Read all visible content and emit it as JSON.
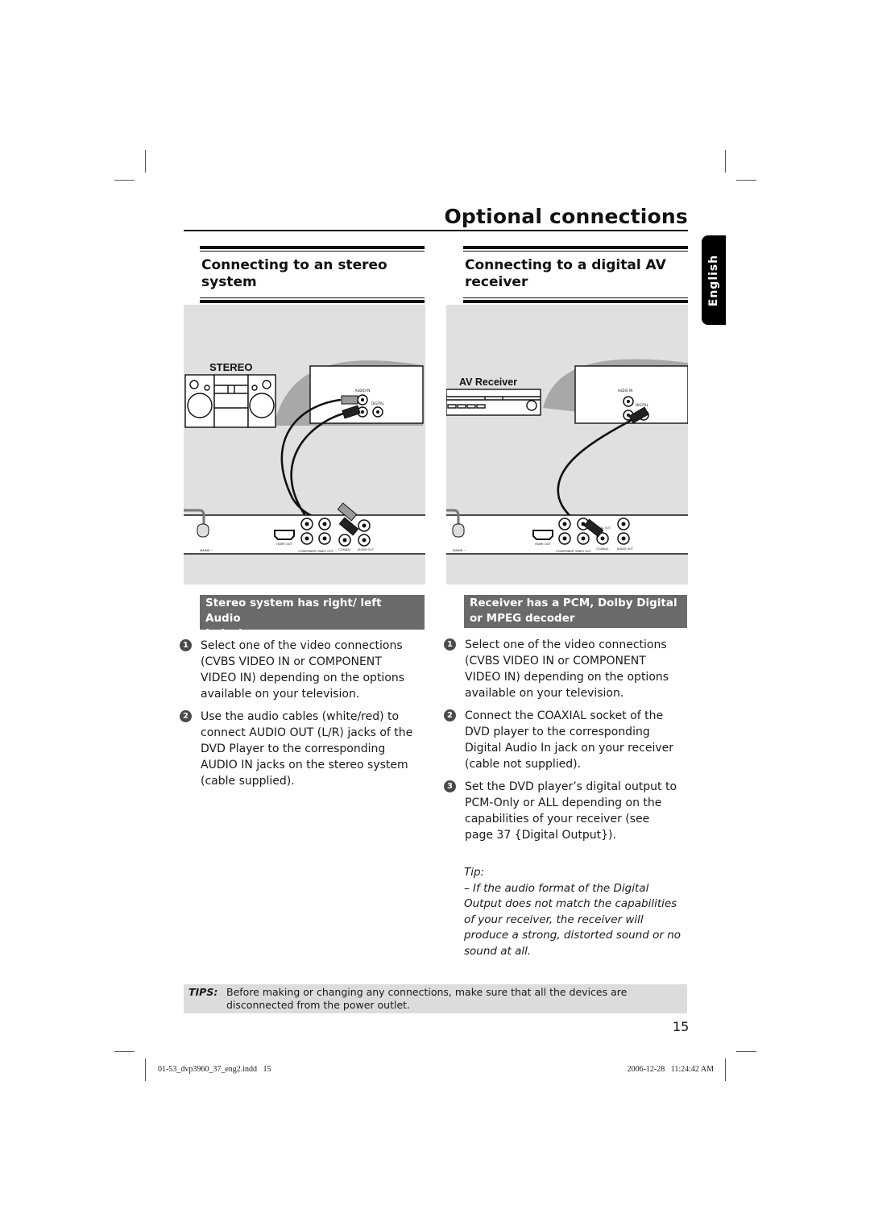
{
  "page": {
    "title": "Optional connections",
    "language_tab": "English",
    "page_number": "15"
  },
  "left_section": {
    "heading": "Connecting to an stereo system",
    "heading_lines": [
      "Connecting to an stereo",
      "system"
    ],
    "figure": {
      "device_label": "STEREO",
      "jack_labels": {
        "audio_in": "AUDIO IN",
        "digital": "DIGITAL",
        "mains": "MAINS ~",
        "hdmi_out": "HDMI OUT",
        "component_video_out": "COMPONENT VIDEO OUT",
        "coaxial": "COAXIAL",
        "audio_out": "AUDIO OUT"
      }
    },
    "condition": [
      "Stereo system has right/ left Audio",
      "In jacks"
    ],
    "steps": [
      {
        "num": "1",
        "text": "Select one of the video connections (CVBS VIDEO IN or COMPONENT VIDEO IN) depending on the options available on your television."
      },
      {
        "num": "2",
        "text": "Use the audio cables (white/red) to connect AUDIO OUT (L/R) jacks of the DVD Player to the corresponding AUDIO IN jacks on the stereo system (cable supplied)."
      }
    ]
  },
  "right_section": {
    "heading": "Connecting to a digital AV receiver",
    "heading_lines": [
      "Connecting to a digital AV",
      "receiver"
    ],
    "figure": {
      "device_label": "AV Receiver",
      "jack_labels": {
        "audio_in": "AUDIO IN",
        "digital": "DIGITAL",
        "mains": "MAINS ~",
        "hdmi_out": "HDMI OUT",
        "component_video_out": "COMPONENT VIDEO OUT",
        "digital_out": "DIGITAL OUT",
        "coaxial": "COAXIAL",
        "audio_out": "AUDIO OUT"
      }
    },
    "condition": [
      "Receiver has a PCM, Dolby Digital",
      "or MPEG decoder"
    ],
    "steps": [
      {
        "num": "1",
        "text": "Select one of the video connections (CVBS VIDEO IN or COMPONENT VIDEO IN) depending on the options available on your television."
      },
      {
        "num": "2",
        "text": "Connect the COAXIAL socket of the DVD player to the corresponding Digital Audio In jack on your receiver (cable not supplied)."
      },
      {
        "num": "3",
        "text": "Set the DVD player’s digital output to PCM-Only or ALL depending on the capabilities of your receiver (see page 37 {Digital Output})."
      }
    ],
    "tip": {
      "label": "Tip:",
      "text": "– If the audio format of the Digital Output does not match the capabilities of your receiver, the receiver will produce a strong, distorted sound or no sound at all."
    }
  },
  "tips_bar": {
    "label": "TIPS:",
    "text": "Before making or changing any connections, make sure that all the devices are disconnected from the power outlet."
  },
  "footer": {
    "file_slug": "01-53_dvp3960_37_eng2.indd   15",
    "timestamp": "2006-12-28   11:24:42 AM"
  }
}
